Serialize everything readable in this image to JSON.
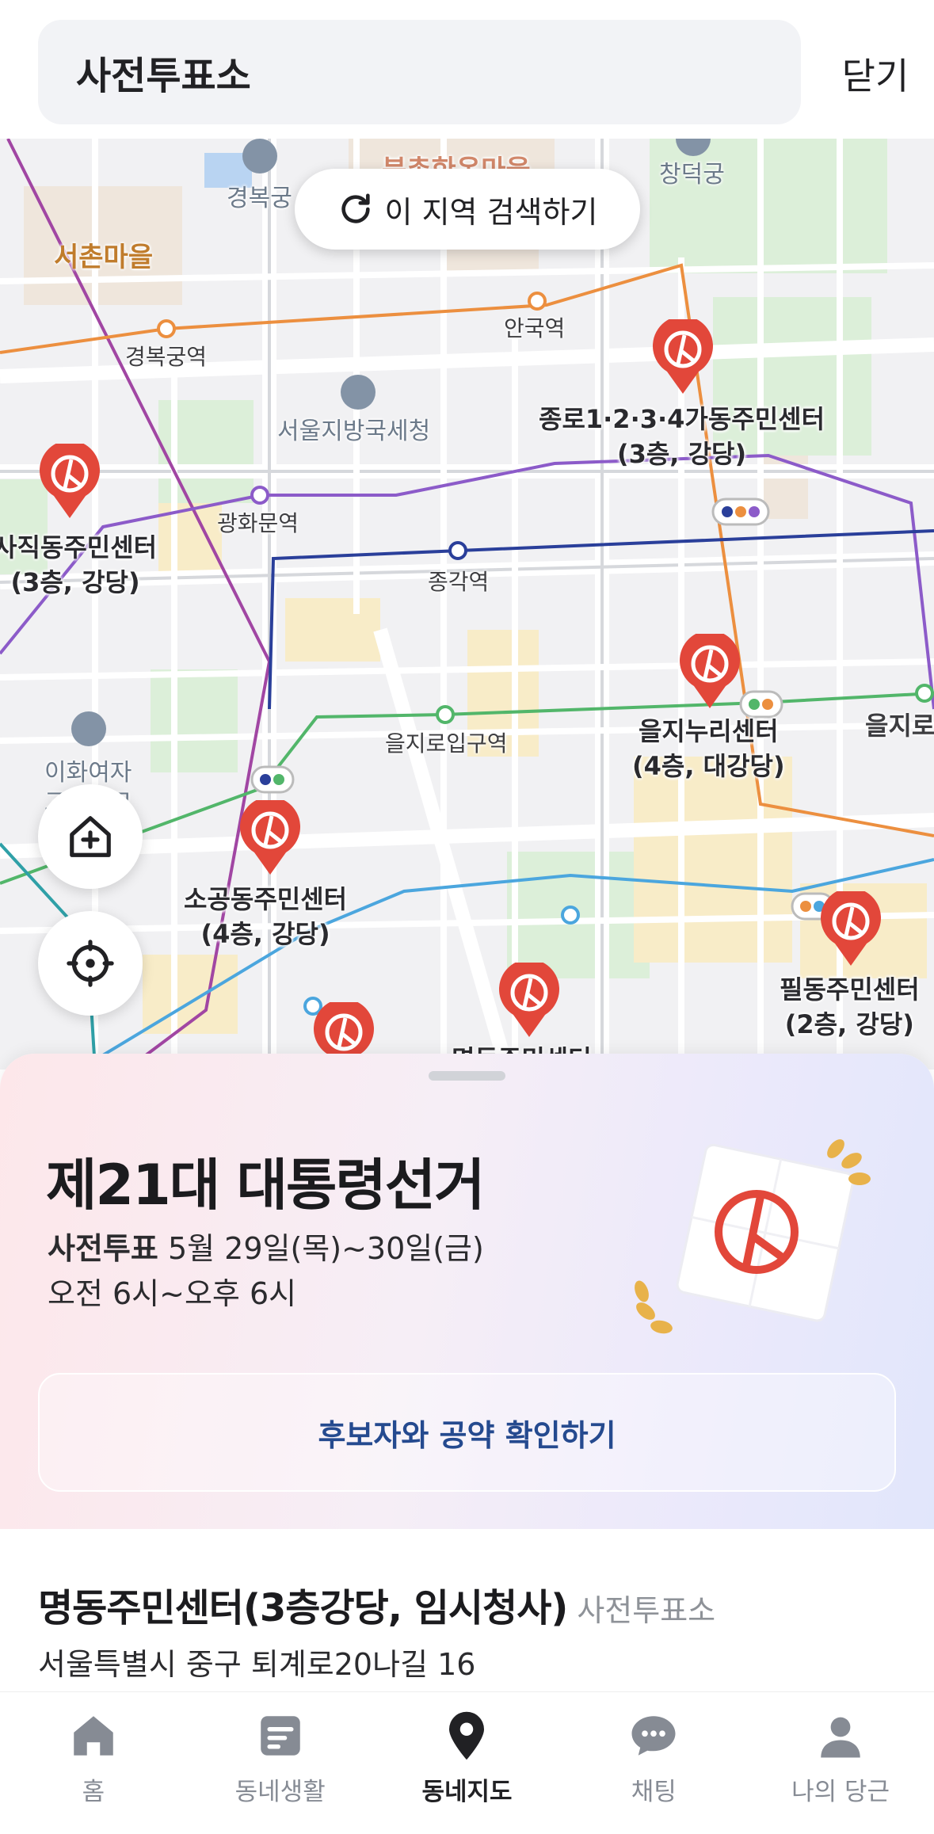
{
  "header": {
    "search_value": "사전투표소",
    "close_label": "닫기"
  },
  "map": {
    "refresh_label": "이 지역 검색하기",
    "labels": {
      "gyeongbokgung": "경복궁",
      "bukchon": "북촌한옥마을",
      "changdeokgung": "창덕궁",
      "seochon": "서촌마을",
      "anguk": "안국역",
      "gyeongbokgung_station": "경복궁역",
      "seoul_tax": "서울지방국세청",
      "gwanghwamun": "광화문역",
      "jonggak": "종각역",
      "euljiro1": "을지로입구역",
      "euljiro_edge": "을지로",
      "ewha": "이화여자",
      "ewha2": "고등학교"
    },
    "places": {
      "jongno": [
        "종로1·2·3·4가동주민센터",
        "(3층, 강당)"
      ],
      "sajik": [
        "사직동주민센터",
        "(3층, 강당)"
      ],
      "euljinuri": [
        "을지누리센터",
        "(4층, 대강당)"
      ],
      "sogong": [
        "소공동주민센터",
        "(4층, 강당)"
      ],
      "pildong": [
        "필동주민센터",
        "(2층, 강당)"
      ],
      "myeongdong": "명동주민센터"
    },
    "colors": {
      "pin": "#e2473a",
      "line_orange": "#ec8f3f",
      "line_purple": "#8c5bc9",
      "line_navy": "#2a3f9a",
      "line_green": "#52b66a",
      "line_blue": "#4ba6de"
    }
  },
  "sheet": {
    "election_title": "제21대 대통령선거",
    "early_vote_label": "사전투표",
    "early_vote_dates": "5월 29일(목)~30일(금)",
    "hours": "오전 6시~오후 6시",
    "cta_label": "후보자와 공약 확인하기",
    "place_name": "명동주민센터(3층강당, 임시청사)",
    "place_type": "사전투표소",
    "place_address": "서울특별시 중구 퇴계로20나길 16"
  },
  "tabbar": {
    "items": [
      {
        "label": "홈",
        "icon": "home-icon",
        "active": false
      },
      {
        "label": "동네생활",
        "icon": "community-icon",
        "active": false
      },
      {
        "label": "동네지도",
        "icon": "map-pin-icon",
        "active": true
      },
      {
        "label": "채팅",
        "icon": "chat-icon",
        "active": false
      },
      {
        "label": "나의 당근",
        "icon": "profile-icon",
        "active": false
      }
    ]
  }
}
